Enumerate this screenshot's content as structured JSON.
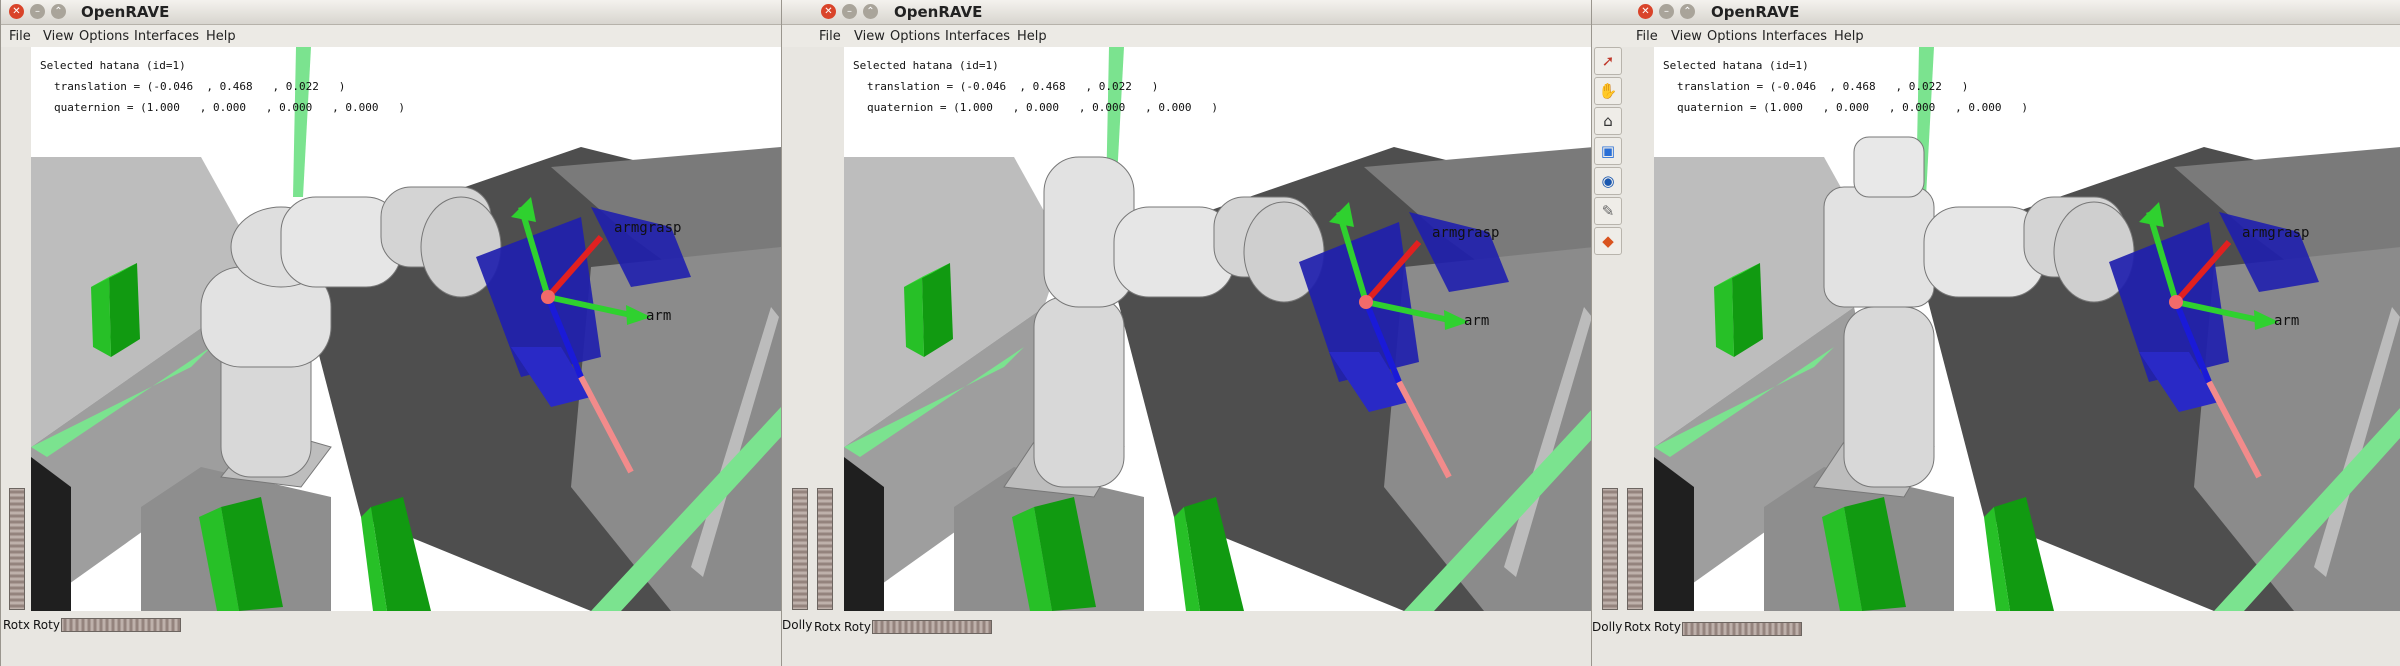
{
  "windows": [
    {
      "title": "OpenRAVE",
      "menu": [
        "File",
        "View",
        "Options",
        "Interfaces",
        "Help"
      ],
      "overlay": {
        "selected": "Selected hatana (id=1)",
        "translation": "translation = (-0.046  , 0.468   , 0.022   )",
        "quaternion": "quaternion = (1.000   , 0.000   , 0.000   , 0.000   )"
      },
      "labels": {
        "manip": "armgrasp",
        "arm": "arm"
      },
      "wheels": {
        "dolly": "",
        "rotx": "Rotx",
        "roty": "Roty"
      }
    },
    {
      "title": "OpenRAVE",
      "menu": [
        "File",
        "View",
        "Options",
        "Interfaces",
        "Help"
      ],
      "overlay": {
        "selected": "Selected hatana (id=1)",
        "translation": "translation = (-0.046  , 0.468   , 0.022   )",
        "quaternion": "quaternion = (1.000   , 0.000   , 0.000   , 0.000   )"
      },
      "labels": {
        "manip": "armgrasp",
        "arm": "arm"
      },
      "wheels": {
        "dolly": "Dolly",
        "rotx": "Rotx",
        "roty": "Roty"
      }
    },
    {
      "title": "OpenRAVE",
      "menu": [
        "File",
        "View",
        "Options",
        "Interfaces",
        "Help"
      ],
      "overlay": {
        "selected": "Selected hatana (id=1)",
        "translation": "translation = (-0.046  , 0.468   , 0.022   )",
        "quaternion": "quaternion = (1.000   , 0.000   , 0.000   , 0.000   )"
      },
      "labels": {
        "manip": "armgrasp",
        "arm": "arm"
      },
      "wheels": {
        "dolly": "Dolly",
        "rotx": "Rotx",
        "roty": "Roty"
      }
    }
  ],
  "tools": [
    {
      "icon": "select-arrow-icon",
      "glyph": "➚",
      "color": "#c0392b"
    },
    {
      "icon": "hand-pan-icon",
      "glyph": "✋",
      "color": "#444444"
    },
    {
      "icon": "home-view-icon",
      "glyph": "⌂",
      "color": "#333333"
    },
    {
      "icon": "view-all-icon",
      "glyph": "▣",
      "color": "#2a6fd6"
    },
    {
      "icon": "seek-eye-icon",
      "glyph": "◉",
      "color": "#1a58b0"
    },
    {
      "icon": "perspective-icon",
      "glyph": "✎",
      "color": "#666666"
    },
    {
      "icon": "cube-projection-icon",
      "glyph": "◆",
      "color": "#d9531e"
    }
  ]
}
